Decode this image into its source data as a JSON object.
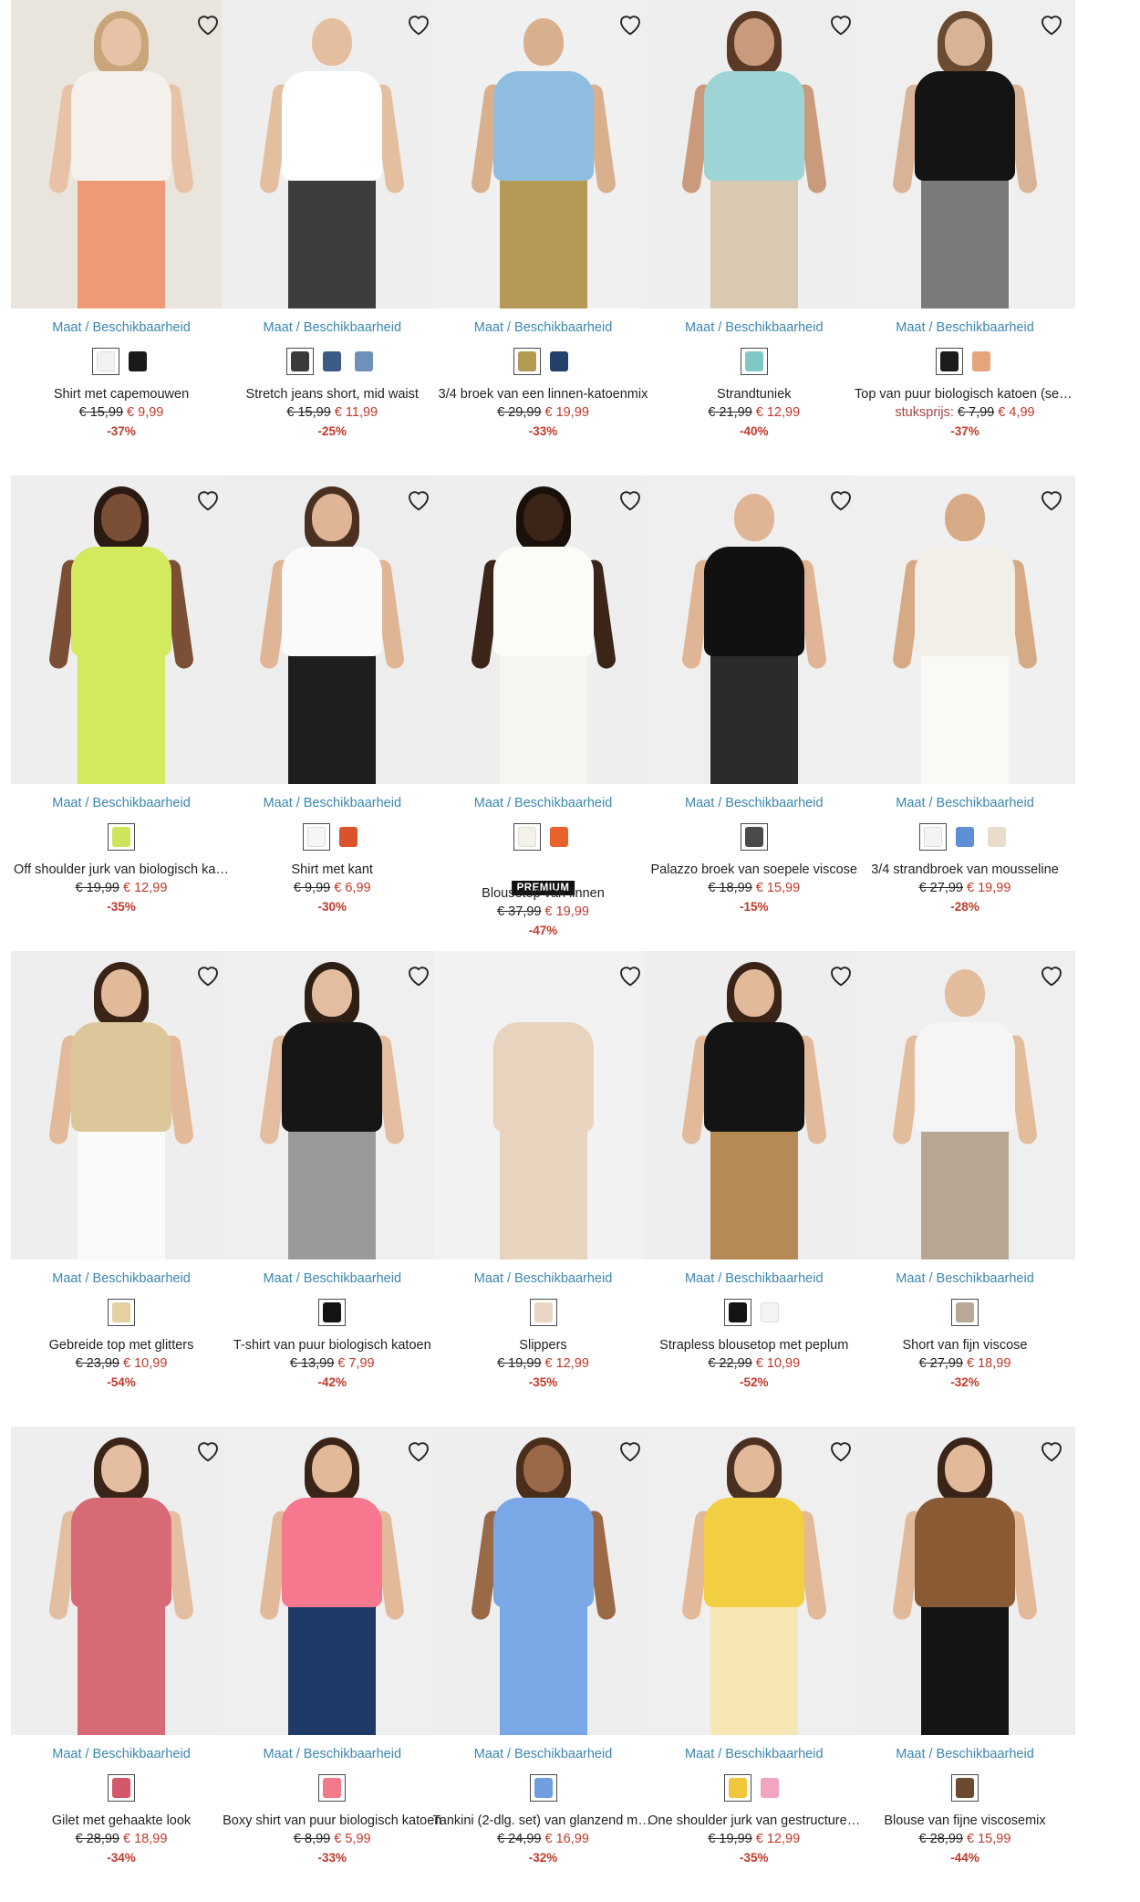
{
  "size_link_label": "Maat / Beschikbaarheid",
  "wishlist_icon": "heart-outline-icon",
  "products": [
    {
      "name": "Shirt met capemouwen",
      "old_price": "€ 15,99",
      "price": "€ 9,99",
      "discount": "-37%",
      "swatches": [
        "#f2f2f2",
        "#1a1a1a"
      ],
      "selected": 0,
      "colors": {
        "bg": "#e9e4dc",
        "top": "#f4f1ec",
        "bottom": "#ee9a76",
        "skin": "#e8c2a6",
        "hair": "#c9a679"
      }
    },
    {
      "name": "Stretch jeans short, mid waist",
      "old_price": "€ 15,99",
      "price": "€ 11,99",
      "discount": "-25%",
      "swatches": [
        "#3a3a3a",
        "#3b5a86",
        "#6f91b8"
      ],
      "selected": 0,
      "colors": {
        "bg": "#eeeeee",
        "top": "#ffffff",
        "bottom": "#3d3d3d",
        "skin": "#e4bf9f",
        "hair": "#eeeeee"
      }
    },
    {
      "name": "3/4 broek van een linnen-katoenmix",
      "old_price": "€ 29,99",
      "price": "€ 19,99",
      "discount": "-33%",
      "swatches": [
        "#b39a52",
        "#24406c"
      ],
      "selected": 0,
      "colors": {
        "bg": "#f0f0f0",
        "top": "#8fbde0",
        "bottom": "#b49a55",
        "skin": "#d9b08e",
        "hair": "#f0f0f0"
      }
    },
    {
      "name": "Strandtuniek",
      "old_price": "€ 21,99",
      "price": "€ 12,99",
      "discount": "-40%",
      "swatches": [
        "#7fc8c4"
      ],
      "selected": 0,
      "colors": {
        "bg": "#eeeeee",
        "top": "#9fd4d7",
        "bottom": "#d8c9b0",
        "skin": "#c99a7b",
        "hair": "#5a3a26"
      }
    },
    {
      "name": "Top van puur biologisch katoen (set…",
      "unit_label": "stuksprijs:",
      "old_price": "€ 7,99",
      "price": "€ 4,99",
      "discount": "-37%",
      "swatches": [
        "#1c1c1c",
        "#e7a57c"
      ],
      "selected": 0,
      "colors": {
        "bg": "#efefef",
        "top": "#141414",
        "bottom": "#7a7a7a",
        "skin": "#d8b396",
        "hair": "#6a4a30"
      }
    },
    {
      "name": "Off shoulder jurk van biologisch ka…",
      "old_price": "€ 19,99",
      "price": "€ 12,99",
      "discount": "-35%",
      "swatches": [
        "#cfe45a"
      ],
      "selected": 0,
      "colors": {
        "bg": "#eeeeee",
        "top": "#d4ea5e",
        "bottom": "#d4ea5e",
        "skin": "#7a4f35",
        "hair": "#2a1a12"
      }
    },
    {
      "name": "Shirt met kant",
      "old_price": "€ 9,99",
      "price": "€ 6,99",
      "discount": "-30%",
      "swatches": [
        "#f6f6f6",
        "#d9532c"
      ],
      "selected": 0,
      "colors": {
        "bg": "#ededed",
        "top": "#fafafa",
        "bottom": "#1e1e1e",
        "skin": "#e0b595",
        "hair": "#4a3020"
      }
    },
    {
      "name": "Blousetop van linnen",
      "badge": "PREMIUM",
      "old_price": "€ 37,99",
      "price": "€ 19,99",
      "discount": "-47%",
      "swatches": [
        "#f3f1ea",
        "#e8622c"
      ],
      "selected": 0,
      "colors": {
        "bg": "#eeeeee",
        "top": "#fbfbf7",
        "bottom": "#f5f5f1",
        "skin": "#3b2418",
        "hair": "#1a100a"
      }
    },
    {
      "name": "Palazzo broek van soepele viscose",
      "old_price": "€ 18,99",
      "price": "€ 15,99",
      "discount": "-15%",
      "swatches": [
        "#4a4a4a"
      ],
      "selected": 0,
      "colors": {
        "bg": "#efefef",
        "top": "#111111",
        "bottom": "#2b2b2b",
        "skin": "#e0b595",
        "hair": "#efefef"
      }
    },
    {
      "name": "3/4 strandbroek van mousseline",
      "old_price": "€ 27,99",
      "price": "€ 19,99",
      "discount": "-28%",
      "swatches": [
        "#f4f4f4",
        "#5c8fd6",
        "#e9dccb"
      ],
      "selected": 0,
      "colors": {
        "bg": "#f0f0f0",
        "top": "#f2efe8",
        "bottom": "#faf9f6",
        "skin": "#d7aa86",
        "hair": "#f0f0f0"
      }
    },
    {
      "name": "Gebreide top met glitters",
      "old_price": "€ 23,99",
      "price": "€ 10,99",
      "discount": "-54%",
      "swatches": [
        "#e4d0a0"
      ],
      "selected": 0,
      "colors": {
        "bg": "#eeeeee",
        "top": "#dcc79a",
        "bottom": "#fafafa",
        "skin": "#e2b999",
        "hair": "#3a2418"
      }
    },
    {
      "name": "T-shirt van puur biologisch katoen",
      "old_price": "€ 13,99",
      "price": "€ 7,99",
      "discount": "-42%",
      "swatches": [
        "#141414"
      ],
      "selected": 0,
      "colors": {
        "bg": "#efefef",
        "top": "#161616",
        "bottom": "#9a9a9a",
        "skin": "#e4bda0",
        "hair": "#2e1e14"
      }
    },
    {
      "name": "Slippers",
      "old_price": "€ 19,99",
      "price": "€ 12,99",
      "discount": "-35%",
      "swatches": [
        "#e8d7c5"
      ],
      "selected": 0,
      "colors": {
        "bg": "#f2f2f2",
        "top": "#e8d3bf",
        "bottom": "#e8d3bf",
        "skin": "#f2f2f2",
        "hair": "#f2f2f2"
      }
    },
    {
      "name": "Strapless blousetop met peplum",
      "old_price": "€ 22,99",
      "price": "€ 10,99",
      "discount": "-52%",
      "swatches": [
        "#141414",
        "#f4f4f4"
      ],
      "selected": 0,
      "colors": {
        "bg": "#eeeeee",
        "top": "#141414",
        "bottom": "#b58a55",
        "skin": "#e2b999",
        "hair": "#3a2418"
      }
    },
    {
      "name": "Short van fijn viscose",
      "old_price": "€ 27,99",
      "price": "€ 18,99",
      "discount": "-32%",
      "swatches": [
        "#b8a894"
      ],
      "selected": 0,
      "colors": {
        "bg": "#efefef",
        "top": "#f5f5f5",
        "bottom": "#b7a792",
        "skin": "#e3bc9c",
        "hair": "#efefef"
      }
    },
    {
      "name": "Gilet met gehaakte look",
      "old_price": "€ 28,99",
      "price": "€ 18,99",
      "discount": "-34%",
      "swatches": [
        "#d5576a"
      ],
      "selected": 0,
      "colors": {
        "bg": "#eeeeee",
        "top": "#d86a76",
        "bottom": "#d86a76",
        "skin": "#e4bea0",
        "hair": "#3a2418"
      }
    },
    {
      "name": "Boxy shirt van puur biologisch katoen",
      "old_price": "€ 8,99",
      "price": "€ 5,99",
      "discount": "-33%",
      "swatches": [
        "#f27a8a"
      ],
      "selected": 0,
      "colors": {
        "bg": "#efefef",
        "top": "#f6778e",
        "bottom": "#1f3a66",
        "skin": "#e2b999",
        "hair": "#3a2418"
      }
    },
    {
      "name": "Tankini (2-dlg. set) van glanzend ma…",
      "old_price": "€ 24,99",
      "price": "€ 16,99",
      "discount": "-32%",
      "swatches": [
        "#6f9fe0"
      ],
      "selected": 0,
      "colors": {
        "bg": "#eeeeee",
        "top": "#7aa7e6",
        "bottom": "#7aa7e6",
        "skin": "#9a6a48",
        "hair": "#4a2e1c"
      }
    },
    {
      "name": "One shoulder jurk van gestructure…",
      "old_price": "€ 19,99",
      "price": "€ 12,99",
      "discount": "-35%",
      "swatches": [
        "#f0c63c",
        "#f2a4c0"
      ],
      "selected": 0,
      "colors": {
        "bg": "#efefef",
        "top": "#f3cf43",
        "bottom": "#f6e7b4",
        "skin": "#e2b999",
        "hair": "#4a3020"
      }
    },
    {
      "name": "Blouse van fijne viscosemix",
      "old_price": "€ 28,99",
      "price": "€ 15,99",
      "discount": "-44%",
      "swatches": [
        "#6b4a2e"
      ],
      "selected": 0,
      "colors": {
        "bg": "#eeeeee",
        "top": "#8a5a34",
        "bottom": "#141414",
        "skin": "#e2b999",
        "hair": "#3a2418"
      }
    }
  ]
}
